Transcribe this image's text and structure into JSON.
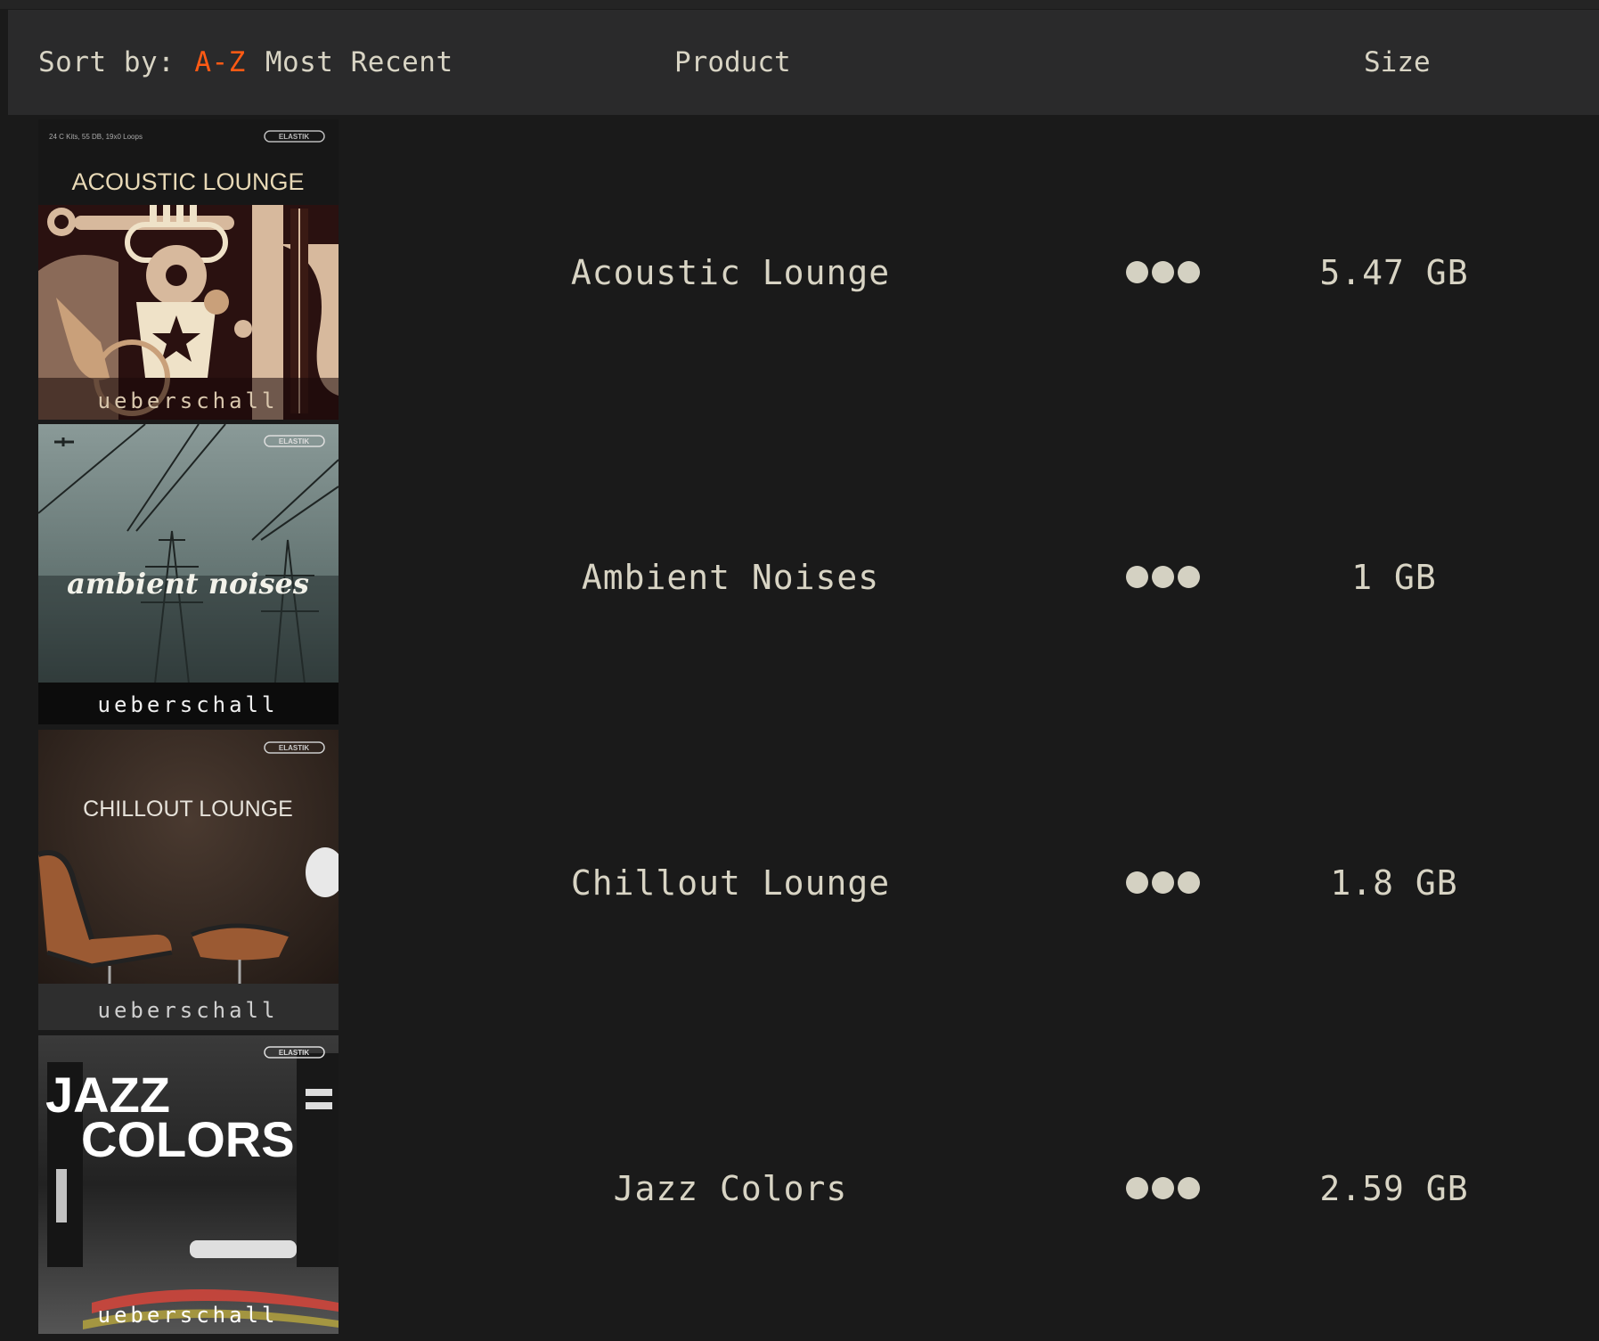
{
  "header": {
    "sort_label": "Sort by:",
    "sort_options": [
      "A-Z",
      "Most Recent"
    ],
    "active_sort": "A-Z",
    "col_product": "Product",
    "col_size": "Size"
  },
  "colors": {
    "accent": "#ff5a14",
    "text": "#d8d4c4",
    "background": "#1a1a1a",
    "header_bg": "#2a2a2b"
  },
  "products": [
    {
      "name": "Acoustic Lounge",
      "size": "5.47 GB",
      "cover": {
        "title": "ACOUSTIC LOUNGE",
        "tagline": "24 C Kits, 55 DB, 19x0 Loops",
        "badge": "ELASTIK",
        "brand": "ueberschall"
      }
    },
    {
      "name": "Ambient Noises",
      "size": "1 GB",
      "cover": {
        "title": "ambient noises",
        "badge": "ELASTIK",
        "brand": "ueberschall"
      }
    },
    {
      "name": "Chillout Lounge",
      "size": "1.8 GB",
      "cover": {
        "title": "CHILLOUT LOUNGE",
        "badge": "ELASTIK",
        "brand": "ueberschall"
      }
    },
    {
      "name": "Jazz Colors",
      "size": "2.59 GB",
      "cover": {
        "title_line1": "JAZZ",
        "title_line2": "COLORS",
        "badge": "ELASTIK",
        "brand": "ueberschall"
      }
    }
  ]
}
